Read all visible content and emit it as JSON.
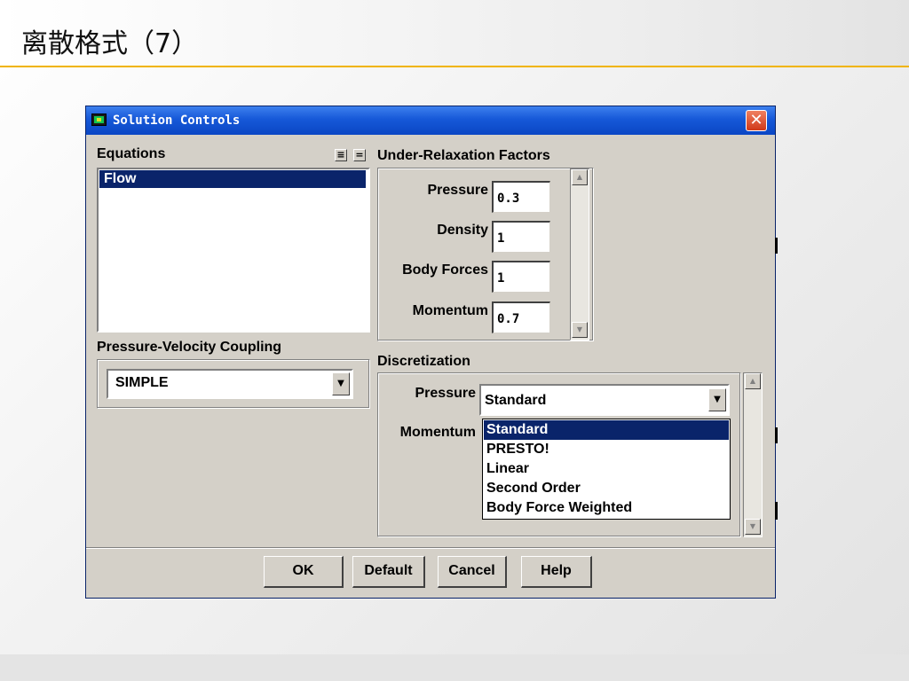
{
  "slide": {
    "title": "离散格式（7）"
  },
  "window": {
    "title": "Solution Controls",
    "close_glyph": "✕",
    "icon": "fluent-app-icon"
  },
  "equations": {
    "label": "Equations",
    "list_btn_all": "≡",
    "list_btn_none": "=",
    "items": [
      "Flow"
    ],
    "selected": "Flow"
  },
  "pv_coupling": {
    "label": "Pressure-Velocity Coupling",
    "value": "SIMPLE"
  },
  "urf": {
    "label": "Under-Relaxation Factors",
    "fields": [
      {
        "label": "Pressure",
        "value": "0.3"
      },
      {
        "label": "Density",
        "value": "1"
      },
      {
        "label": "Body Forces",
        "value": "1"
      },
      {
        "label": "Momentum",
        "value": "0.7"
      }
    ]
  },
  "discretization": {
    "label": "Discretization",
    "pressure_label": "Pressure",
    "pressure_value": "Standard",
    "momentum_label": "Momentum",
    "options": [
      "Standard",
      "PRESTO!",
      "Linear",
      "Second Order",
      "Body Force Weighted"
    ],
    "highlighted": "Standard"
  },
  "buttons": {
    "ok": "OK",
    "default": "Default",
    "cancel": "Cancel",
    "help": "Help"
  },
  "icons": {
    "dropdown": "▼",
    "scroll_up": "▲",
    "scroll_down": "▼"
  },
  "colors": {
    "titlebar": "#1658d8",
    "selection": "#0a246a",
    "dialog_face": "#d4d0c8",
    "accent_line": "#f0b400"
  }
}
